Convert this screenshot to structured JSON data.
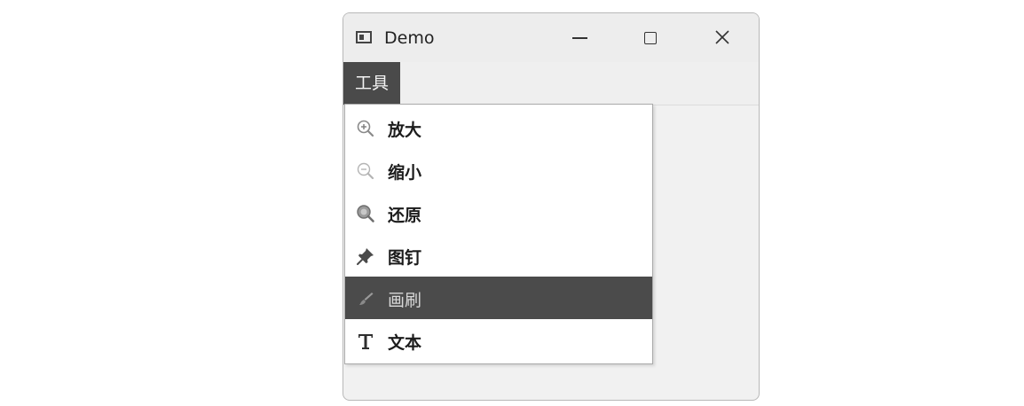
{
  "window": {
    "title": "Demo"
  },
  "menubar": {
    "tools_label": "工具"
  },
  "menu": {
    "items": [
      {
        "label": "放大",
        "icon": "zoom-in-icon"
      },
      {
        "label": "缩小",
        "icon": "zoom-out-icon"
      },
      {
        "label": "还原",
        "icon": "zoom-reset-icon"
      },
      {
        "label": "图钉",
        "icon": "pin-icon"
      },
      {
        "label": "画刷",
        "icon": "brush-icon",
        "selected": true
      },
      {
        "label": "文本",
        "icon": "text-icon"
      }
    ]
  },
  "colors": {
    "selected_bg": "#4b4b4b",
    "menubar_active_bg": "#4a4a4a"
  }
}
